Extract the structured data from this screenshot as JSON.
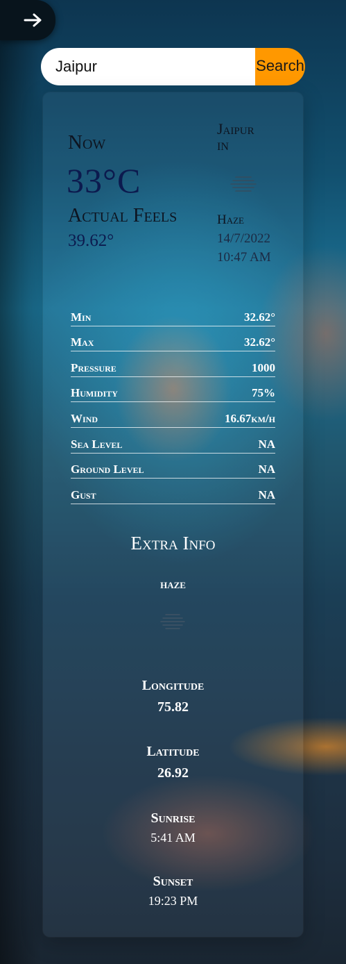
{
  "nav": {
    "toggle_icon": "arrow-right-icon"
  },
  "search": {
    "value": "Jaipur",
    "placeholder": "",
    "button_label": "Search",
    "button_color": "#ff9800"
  },
  "current": {
    "now_label": "Now",
    "temperature": "33°C",
    "feels_label": "Actual Feels",
    "feels_value": "39.62°",
    "city": "Jaipur",
    "country": "IN",
    "description": "Haze",
    "date": "14/7/2022",
    "time": "10:47 AM",
    "icon": "haze-icon"
  },
  "stats": [
    {
      "label": "Min",
      "value": "32.62°"
    },
    {
      "label": "Max",
      "value": "32.62°"
    },
    {
      "label": "Pressure",
      "value": "1000"
    },
    {
      "label": "Humidity",
      "value": "75%"
    },
    {
      "label": "Wind",
      "value": "16.67km/h"
    },
    {
      "label": "Sea Level",
      "value": "NA"
    },
    {
      "label": "Ground Level",
      "value": "NA"
    },
    {
      "label": "Gust",
      "value": "NA"
    }
  ],
  "extra": {
    "title": "Extra Info",
    "description": "haze",
    "icon": "haze-icon",
    "longitude_label": "Longitude",
    "longitude_value": "75.82",
    "latitude_label": "Latitude",
    "latitude_value": "26.92",
    "sunrise_label": "Sunrise",
    "sunrise_value": "5:41 AM",
    "sunset_label": "Sunset",
    "sunset_value": "19:23 PM"
  }
}
